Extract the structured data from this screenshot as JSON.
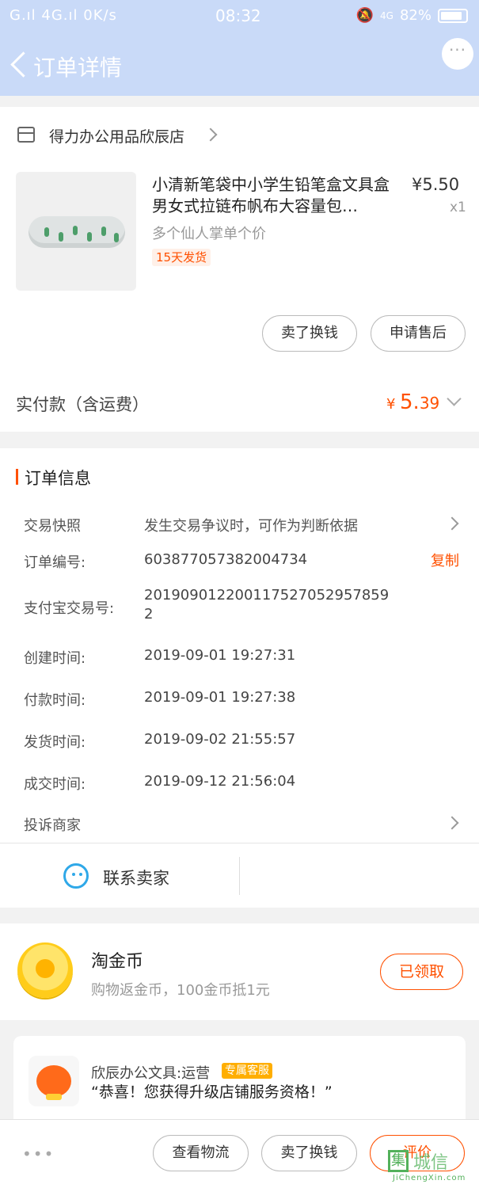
{
  "status_bar": {
    "left": "G.ıl 4G.ıl 0K/s",
    "time": "08:32",
    "network": "4G",
    "battery": "82%"
  },
  "nav": {
    "title": "订单详情",
    "more": "···"
  },
  "shop": {
    "name": "得力办公用品欣辰店"
  },
  "product": {
    "title": "小清新笔袋中小学生铅笔盒文具盒男女式拉链布帆布大容量包…",
    "sku": "多个仙人掌单个价",
    "tag": "15天发货",
    "price": "¥5.50",
    "qty": "x1"
  },
  "product_actions": {
    "sell": "卖了换钱",
    "after_sale": "申请售后"
  },
  "payment": {
    "label": "实付款（含运费）",
    "currency": "¥",
    "amount_int": "5.",
    "amount_dec": "39"
  },
  "order_info": {
    "title": "订单信息",
    "snapshot_label": "交易快照",
    "snapshot_value": "发生交易争议时，可作为判断依据",
    "order_no_label": "订单编号:",
    "order_no": "603877057382004734",
    "copy": "复制",
    "alipay_label": "支付宝交易号:",
    "alipay_line1": "201909012200117527052957859",
    "alipay_line2": "2",
    "created_label": "创建时间:",
    "created": "2019-09-01 19:27:31",
    "paid_label": "付款时间:",
    "paid": "2019-09-01 19:27:38",
    "shipped_label": "发货时间:",
    "shipped": "2019-09-02 21:55:57",
    "closed_label": "成交时间:",
    "closed": "2019-09-12 21:56:04",
    "complain": "投诉商家"
  },
  "contact": {
    "label": "联系卖家"
  },
  "coins": {
    "title": "淘金币",
    "desc": "购物返金币，100金币抵1元",
    "button": "已领取"
  },
  "service": {
    "name": "欣辰办公文具:运营",
    "tag": "专属客服",
    "message": "“恭喜！您获得升级店铺服务资格！”"
  },
  "bottom_bar": {
    "more": "•••",
    "logistics": "查看物流",
    "sell": "卖了换钱",
    "review": "评价"
  },
  "watermark": {
    "char": "集",
    "text": "城信",
    "sub": "JiChengXin.com"
  },
  "colors": {
    "accent": "#ff5000",
    "header": "#c9daf8",
    "contact": "#2fa8e8"
  }
}
